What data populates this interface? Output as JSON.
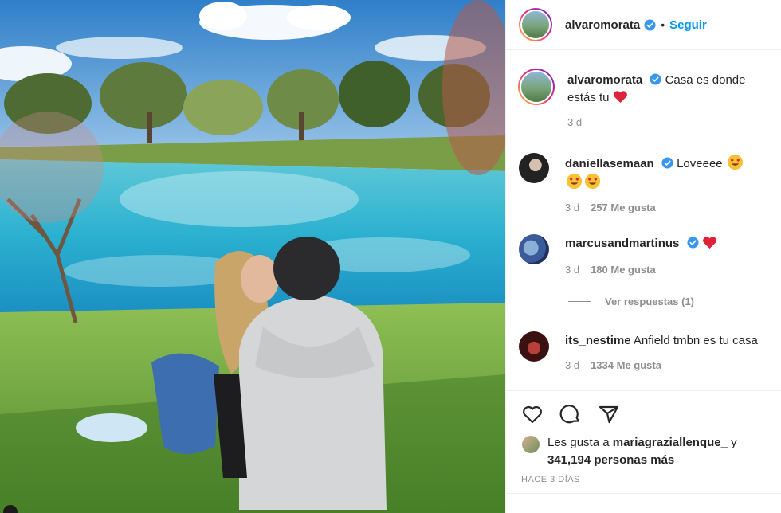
{
  "post": {
    "author": "alvaromorata",
    "follow_label": "Seguir",
    "separator": "•",
    "caption_text": "Casa es donde estás tu",
    "caption_time": "3 d"
  },
  "comments": [
    {
      "user": "daniellasemaan",
      "text": "Loveeee",
      "time": "3 d",
      "likes": "257 Me gusta"
    },
    {
      "user": "marcusandmartinus",
      "text": "",
      "time": "3 d",
      "likes": "180 Me gusta"
    },
    {
      "user": "its_nestime",
      "text": "Anfield tmbn es tu casa",
      "time": "3 d",
      "likes": "1334 Me gusta"
    }
  ],
  "view_replies": "Ver respuestas (1)",
  "likes_summary": {
    "prefix": "Les gusta a",
    "user": "mariagraziallenque_",
    "joiner": "y",
    "others": "341,194 personas más"
  },
  "time_ago": "HACE 3 DÍAS",
  "icons": [
    "heart-icon",
    "comment-icon",
    "share-icon",
    "verified-badge-icon",
    "red-heart-emoji",
    "heart-eyes-emoji"
  ],
  "colors": {
    "link": "#0095f6",
    "verified": "#3897f0",
    "heart": "#ed4956",
    "muted": "#8e8e8e"
  }
}
